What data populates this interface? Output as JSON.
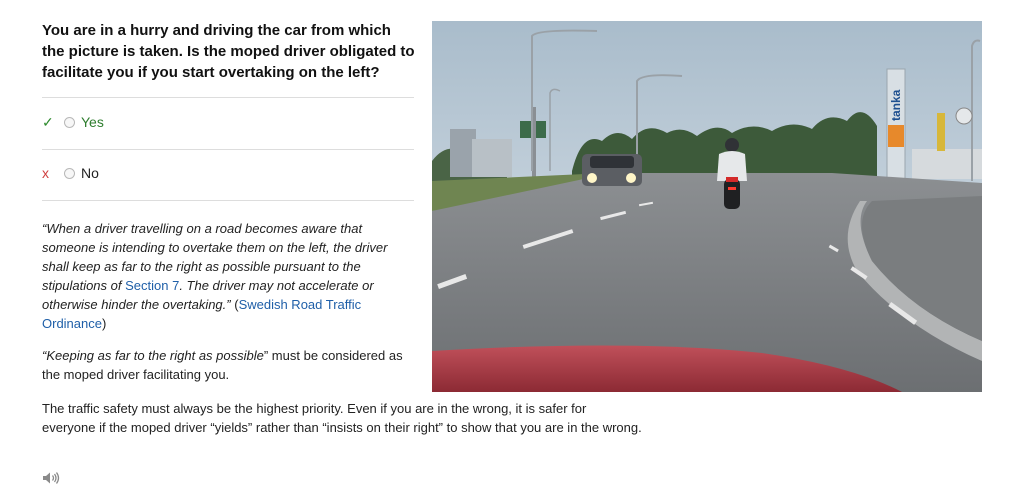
{
  "question": "You are in a hurry and driving the car from which the picture is taken. Is the moped driver obligated to facilitate you if you start overtaking on the left?",
  "answers": [
    {
      "mark": "✓",
      "label": "Yes",
      "status": "correct"
    },
    {
      "mark": "x",
      "label": "No",
      "status": "incorrect"
    }
  ],
  "explanation": {
    "quote_part1": "“When a driver travelling on a road becomes aware that someone is intending to overtake them on the left, the driver shall keep as far to the right as possible pursuant to the stipulations of ",
    "section_link": "Section 7",
    "quote_part2": ". The driver may not accelerate or otherwise hinder the overtaking.”",
    "source_open": " (",
    "source_link": "Swedish Road Traffic Ordinance",
    "source_close": ")",
    "para2_quote": "“Keeping as far to the right as possible",
    "para2_rest": "” must be considered as the moped driver facilitating you.",
    "para3": "The traffic safety must always be the highest priority. Even if you are in the wrong, it is safer for everyone if the moped driver “yields” rather than “insists on their right” to show that you are in the wrong."
  },
  "photo": {
    "sign_text": "tanka"
  },
  "colors": {
    "correct": "#2e8b2e",
    "incorrect": "#d04040",
    "link": "#1f5fa8"
  },
  "icons": {
    "audio": "speaker-icon"
  }
}
